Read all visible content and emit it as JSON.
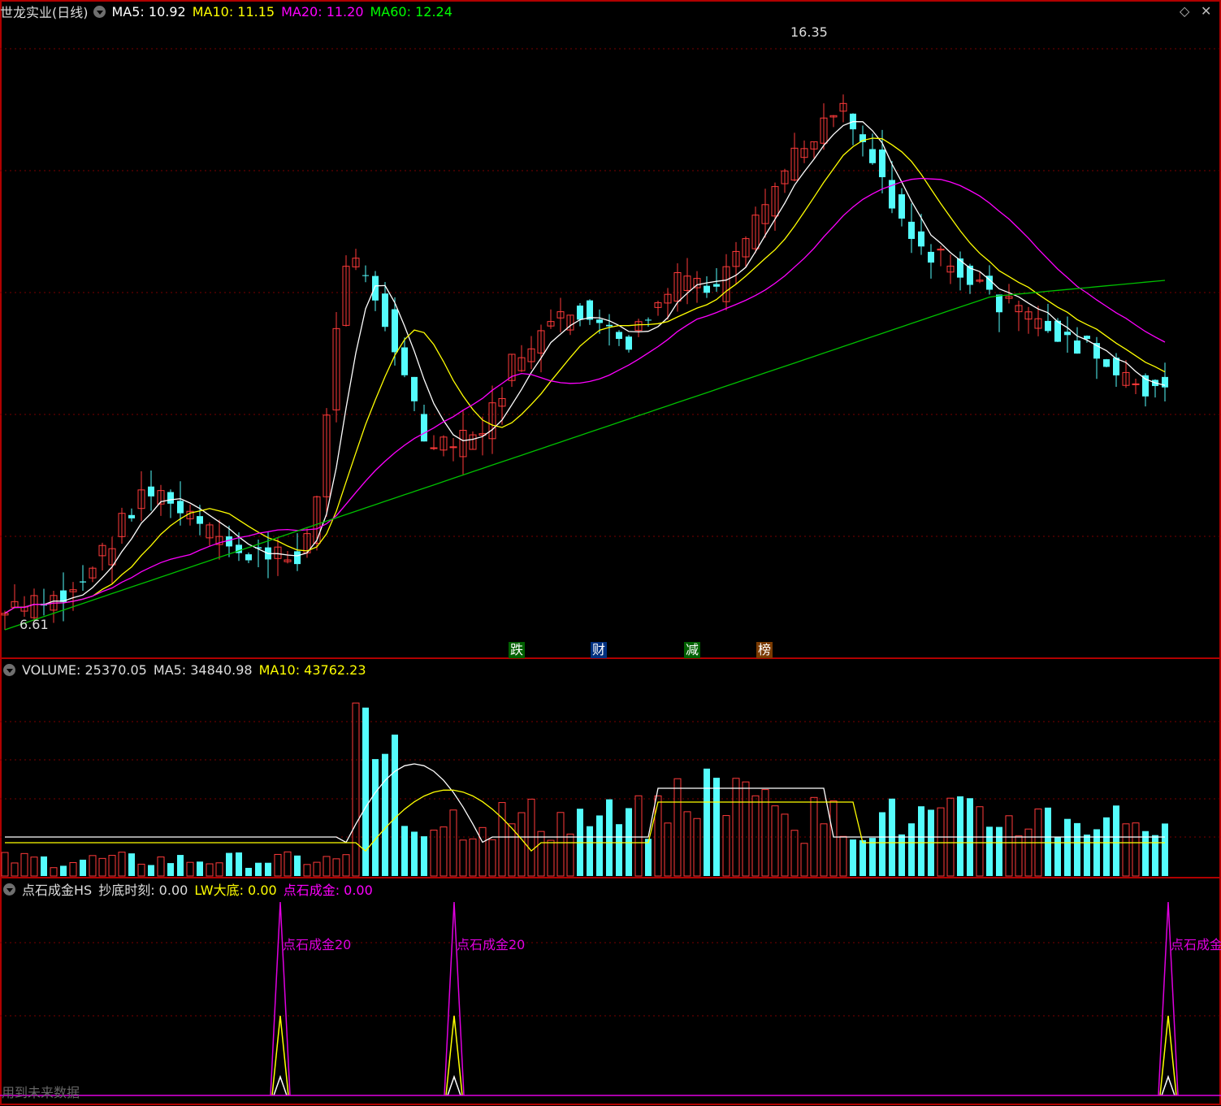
{
  "main": {
    "stock": "世龙实业(日线)",
    "ma5": "MA5: 10.92",
    "ma10": "MA10: 11.15",
    "ma20": "MA20: 11.20",
    "ma60": "MA60: 12.24",
    "high": "16.35",
    "low": "6.61"
  },
  "events": [
    "跌",
    "财",
    "减",
    "榜"
  ],
  "volume": {
    "volume": "VOLUME: 25370.05",
    "ma5": "MA5: 34840.98",
    "ma10": "MA10: 43762.23"
  },
  "indicator": {
    "name": "点石成金HS",
    "chaodi": "抄底时刻: 0.00",
    "lw": "LW大底: 0.00",
    "dsc": "点石成金: 0.00",
    "peak_label": "点石成金20"
  },
  "toolbar": {
    "diamond": "◇",
    "close": "✕"
  },
  "note": "用到未来数据",
  "colors": {
    "up": "#ff3a3a",
    "down": "#54fcfc",
    "ma5": "#ffffff",
    "ma10": "#ffff00",
    "ma20": "#ff00ff",
    "ma60": "#00c000",
    "border": "#b00000"
  },
  "chart_data": {
    "type": "candlestick",
    "series": [
      {
        "name": "MA5",
        "value": 10.92
      },
      {
        "name": "MA10",
        "value": 11.15
      },
      {
        "name": "MA20",
        "value": 11.2
      },
      {
        "name": "MA60",
        "value": 12.24
      }
    ],
    "high": 16.35,
    "low": 6.61,
    "volume_series": [
      {
        "name": "VOLUME",
        "value": 25370.05
      },
      {
        "name": "MA5",
        "value": 34840.98
      },
      {
        "name": "MA10",
        "value": 43762.23
      }
    ]
  }
}
